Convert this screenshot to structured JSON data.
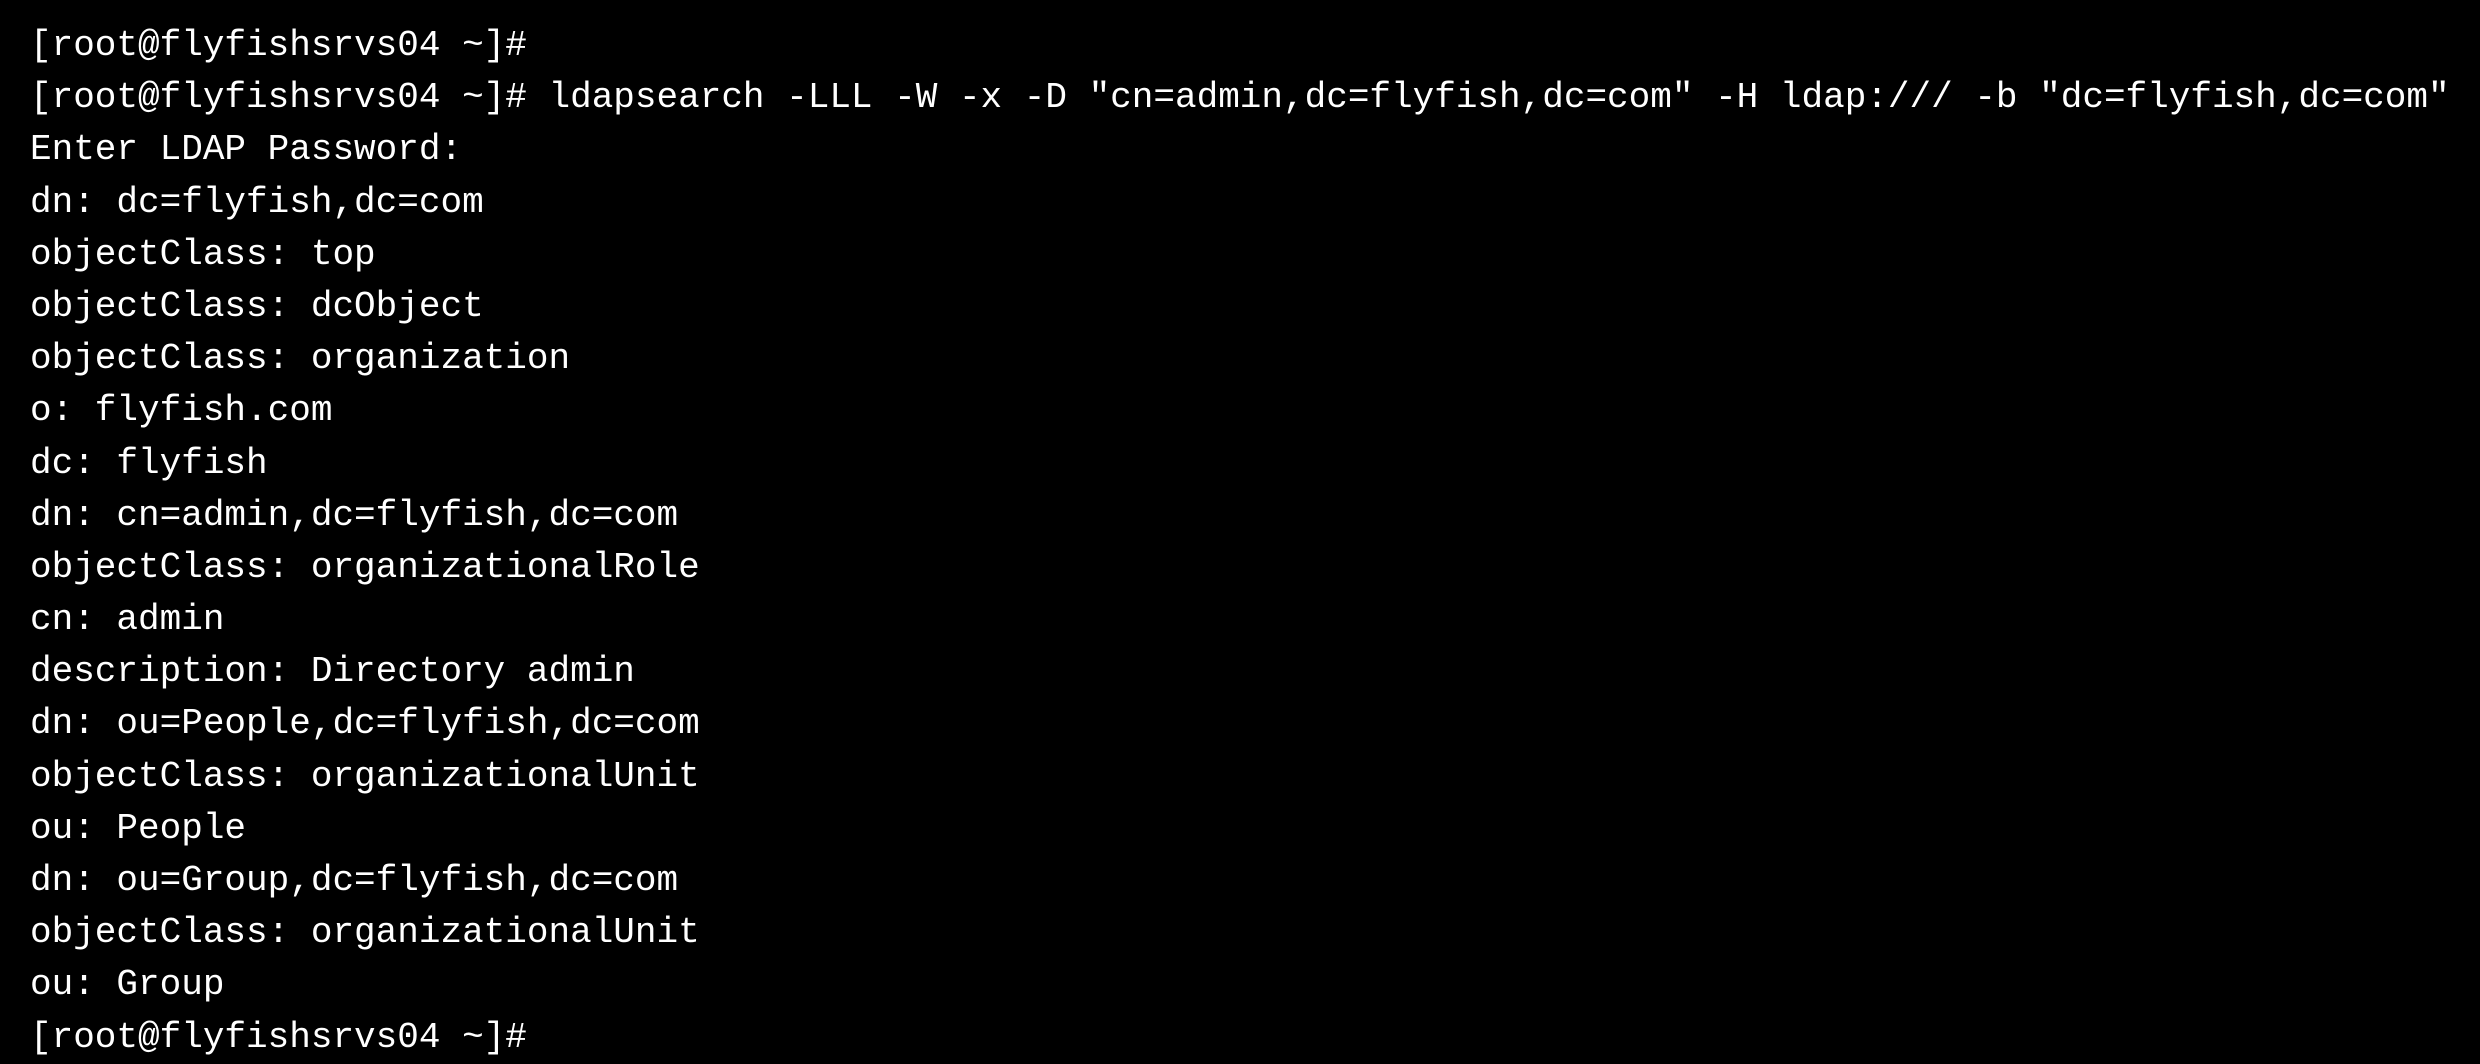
{
  "terminal": {
    "lines": [
      {
        "id": "prompt1",
        "text": "[root@flyfishsrvs04 ~]#"
      },
      {
        "id": "command1",
        "text": "[root@flyfishsrvs04 ~]# ldapsearch -LLL -W -x -D \"cn=admin,dc=flyfish,dc=com\" -H ldap:/// -b \"dc=flyfish,dc=com\""
      },
      {
        "id": "line1",
        "text": "Enter LDAP Password:"
      },
      {
        "id": "line2",
        "text": "dn: dc=flyfish,dc=com"
      },
      {
        "id": "line3",
        "text": "objectClass: top"
      },
      {
        "id": "line4",
        "text": "objectClass: dcObject"
      },
      {
        "id": "line5",
        "text": "objectClass: organization"
      },
      {
        "id": "line6",
        "text": "o: flyfish.com"
      },
      {
        "id": "line7",
        "text": "dc: flyfish"
      },
      {
        "id": "blank1",
        "text": ""
      },
      {
        "id": "line8",
        "text": "dn: cn=admin,dc=flyfish,dc=com"
      },
      {
        "id": "line9",
        "text": "objectClass: organizationalRole"
      },
      {
        "id": "line10",
        "text": "cn: admin"
      },
      {
        "id": "line11",
        "text": "description: Directory admin"
      },
      {
        "id": "blank2",
        "text": ""
      },
      {
        "id": "line12",
        "text": "dn: ou=People,dc=flyfish,dc=com"
      },
      {
        "id": "line13",
        "text": "objectClass: organizationalUnit"
      },
      {
        "id": "line14",
        "text": "ou: People"
      },
      {
        "id": "blank3",
        "text": ""
      },
      {
        "id": "line15",
        "text": "dn: ou=Group,dc=flyfish,dc=com"
      },
      {
        "id": "line16",
        "text": "objectClass: organizationalUnit"
      },
      {
        "id": "line17",
        "text": "ou: Group"
      },
      {
        "id": "blank4",
        "text": ""
      },
      {
        "id": "prompt2",
        "text": "[root@flyfishsrvs04 ~]#"
      }
    ]
  }
}
